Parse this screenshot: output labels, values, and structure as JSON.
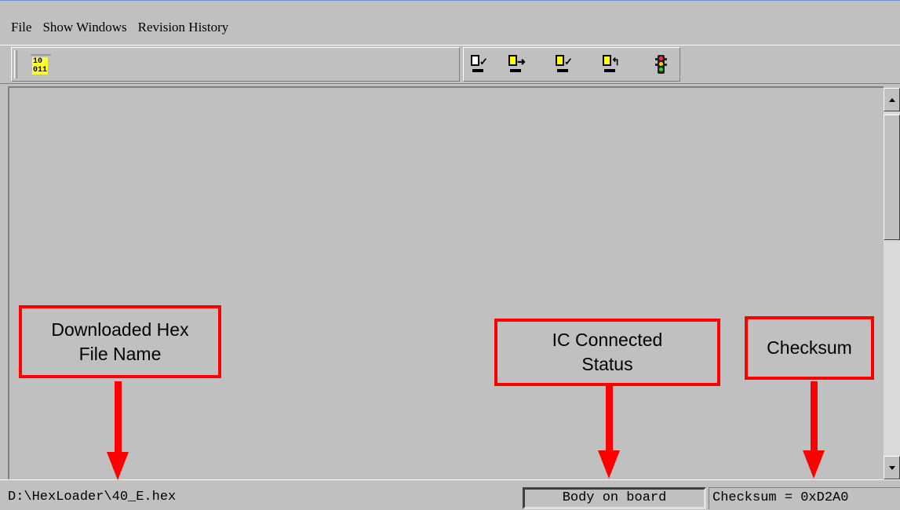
{
  "menu": [
    {
      "label": "File"
    },
    {
      "label": "Show Windows"
    },
    {
      "label": "Revision History"
    }
  ],
  "toolbar": {
    "hex_icon_text": {
      "line1": "10",
      "line2": "011"
    },
    "icons": [
      "hex-file-icon",
      "check-document-icon",
      "send-document-icon",
      "verify-document-icon",
      "upload-document-icon",
      "traffic-light-icon"
    ]
  },
  "status": {
    "file_path": "D:\\HexLoader\\40_E.hex",
    "connection": "Body on board",
    "checksum": "Checksum = 0xD2A0"
  },
  "annotations": {
    "file_name": {
      "line1": "Downloaded Hex",
      "line2": "File Name"
    },
    "connected_status": {
      "line1": "IC Connected",
      "line2": "Status"
    },
    "checksum": "Checksum"
  },
  "colors": {
    "window_bg": "#c0c0c0",
    "annotation": "#ff0000",
    "icon_yellow": "#ffff00"
  }
}
